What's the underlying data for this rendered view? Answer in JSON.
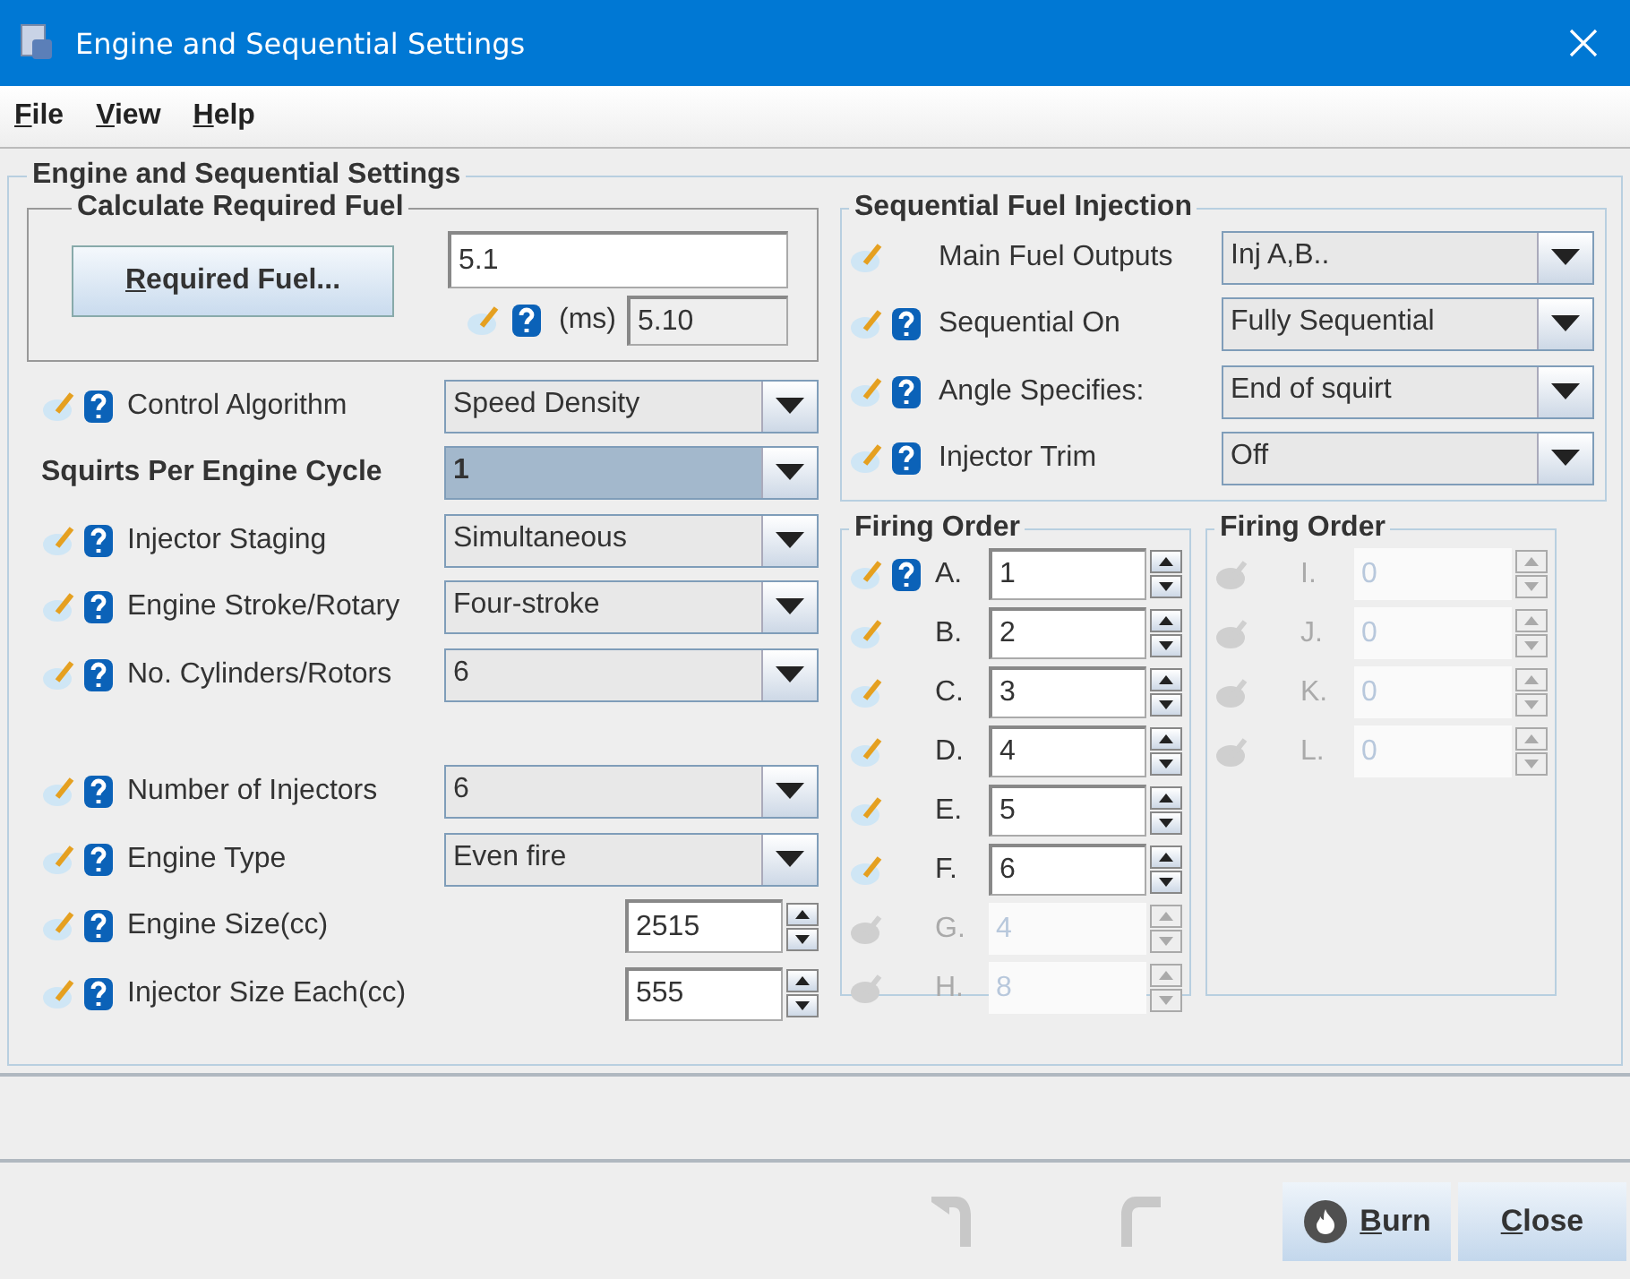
{
  "window": {
    "title": "Engine and Sequential Settings"
  },
  "menu": [
    {
      "label": "File",
      "mnemonic": true
    },
    {
      "label": "View",
      "mnemonic": true
    },
    {
      "label": "Help",
      "mnemonic": true
    }
  ],
  "panel_title": "Engine and Sequential Settings",
  "required_fuel": {
    "title": "Calculate Required Fuel",
    "button": {
      "label": "Required Fuel...",
      "mnemonic": true
    },
    "value": "5.1",
    "unit": "(ms)",
    "computed": "5.10"
  },
  "settings_top": [
    {
      "kind": "combo",
      "label": "Control Algorithm",
      "value": "Speed Density",
      "edit": true,
      "help": true,
      "selected": false
    },
    {
      "kind": "combo",
      "label": "Squirts Per Engine Cycle",
      "value": "1",
      "edit": false,
      "help": false,
      "selected": true
    },
    {
      "kind": "combo",
      "label": "Injector Staging",
      "value": "Simultaneous",
      "edit": true,
      "help": true,
      "selected": false
    },
    {
      "kind": "combo",
      "label": "Engine Stroke/Rotary",
      "value": "Four-stroke",
      "edit": true,
      "help": true,
      "selected": false
    },
    {
      "kind": "combo",
      "label": "No. Cylinders/Rotors",
      "value": "6",
      "edit": true,
      "help": true,
      "selected": false
    }
  ],
  "settings_bottom": [
    {
      "kind": "combo",
      "label": "Number of Injectors",
      "value": "6",
      "edit": true,
      "help": true,
      "selected": false
    },
    {
      "kind": "combo",
      "label": "Engine Type",
      "value": "Even fire",
      "edit": true,
      "help": true,
      "selected": false
    },
    {
      "kind": "spinner",
      "label": "Engine Size(cc)",
      "value": "2515",
      "edit": true,
      "help": true,
      "selected": false
    },
    {
      "kind": "spinner",
      "label": "Injector Size Each(cc)",
      "value": "555",
      "edit": true,
      "help": true,
      "selected": false
    }
  ],
  "sequential": {
    "title": "Sequential Fuel Injection",
    "rows": [
      {
        "label": "Main Fuel Outputs",
        "value": "Inj A,B..",
        "help": false
      },
      {
        "label": "Sequential On",
        "value": "Fully Sequential",
        "help": true
      },
      {
        "label": "Angle Specifies:",
        "value": "End of squirt",
        "help": true
      },
      {
        "label": "Injector Trim",
        "value": "Off",
        "help": true
      }
    ]
  },
  "firing_orders": [
    {
      "title": "Firing Order",
      "rows": [
        {
          "letter": "A.",
          "value": "1",
          "enabled": true,
          "help": true
        },
        {
          "letter": "B.",
          "value": "2",
          "enabled": true,
          "help": false
        },
        {
          "letter": "C.",
          "value": "3",
          "enabled": true,
          "help": false
        },
        {
          "letter": "D.",
          "value": "4",
          "enabled": true,
          "help": false
        },
        {
          "letter": "E.",
          "value": "5",
          "enabled": true,
          "help": false
        },
        {
          "letter": "F.",
          "value": "6",
          "enabled": true,
          "help": false
        },
        {
          "letter": "G.",
          "value": "4",
          "enabled": false,
          "help": false
        },
        {
          "letter": "H.",
          "value": "8",
          "enabled": false,
          "help": false
        }
      ]
    },
    {
      "title": "Firing Order",
      "rows": [
        {
          "letter": "I.",
          "value": "0",
          "enabled": false,
          "help": false
        },
        {
          "letter": "J.",
          "value": "0",
          "enabled": false,
          "help": false
        },
        {
          "letter": "K.",
          "value": "0",
          "enabled": false,
          "help": false
        },
        {
          "letter": "L.",
          "value": "0",
          "enabled": false,
          "help": false
        }
      ]
    }
  ],
  "footer": {
    "undo": {
      "disabled": true
    },
    "redo": {
      "disabled": true
    },
    "buttons": [
      {
        "kind": "burn",
        "label": "Burn",
        "mnemonic": true
      },
      {
        "kind": "close",
        "label": "Close",
        "mnemonic": true
      }
    ]
  }
}
